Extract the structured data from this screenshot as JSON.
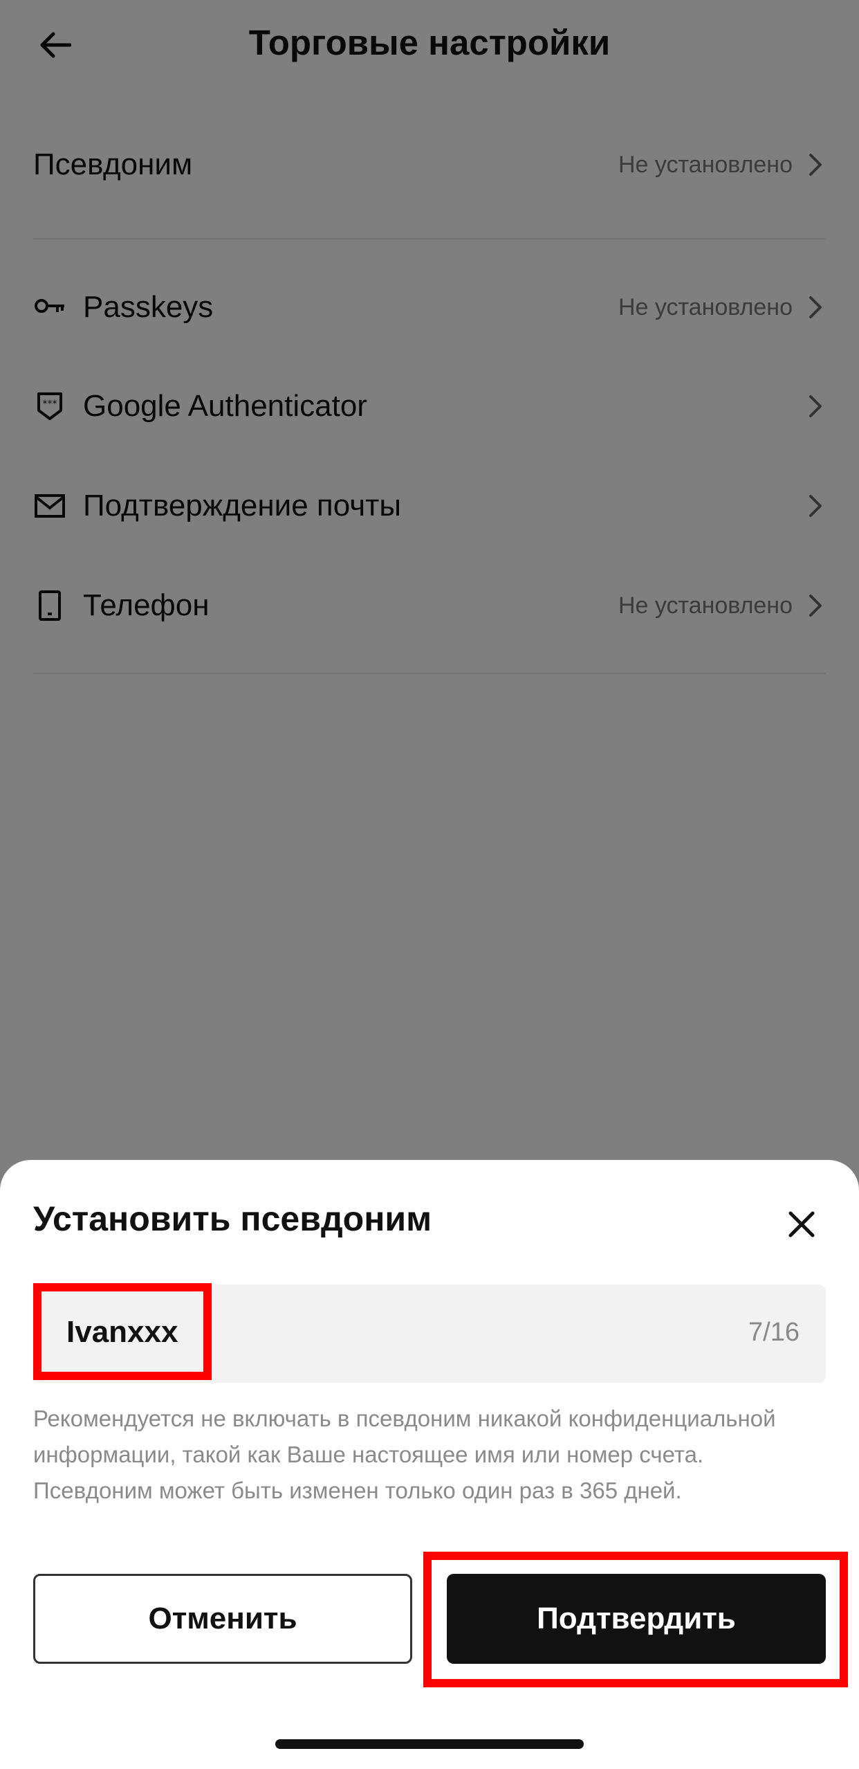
{
  "header": {
    "title": "Торговые настройки",
    "back_icon": "arrow-left-icon"
  },
  "settings": {
    "pseudonym": {
      "label": "Псевдоним",
      "value": "Не установлено"
    },
    "passkeys": {
      "label": "Passkeys",
      "value": "Не установлено",
      "icon": "key-icon"
    },
    "google_auth": {
      "label": "Google Authenticator",
      "value": "",
      "icon": "shield-icon"
    },
    "email": {
      "label": "Подтверждение почты",
      "value": "",
      "icon": "mail-icon"
    },
    "phone": {
      "label": "Телефон",
      "value": "Не установлено",
      "icon": "phone-icon"
    }
  },
  "sheet": {
    "title": "Установить псевдоним",
    "close_icon": "close-icon",
    "input_value": "Ivanxxx",
    "counter": "7/16",
    "hint": "Рекомендуется не включать в псевдоним никакой конфиденциальной информации, такой как Ваше настоящее имя или номер счета. Псевдоним может быть изменен только один раз в 365 дней.",
    "cancel_label": "Отменить",
    "confirm_label": "Подтвердить"
  },
  "colors": {
    "accent": "#111111",
    "highlight": "#ff0000",
    "overlay": "rgba(0,0,0,0.5)"
  }
}
